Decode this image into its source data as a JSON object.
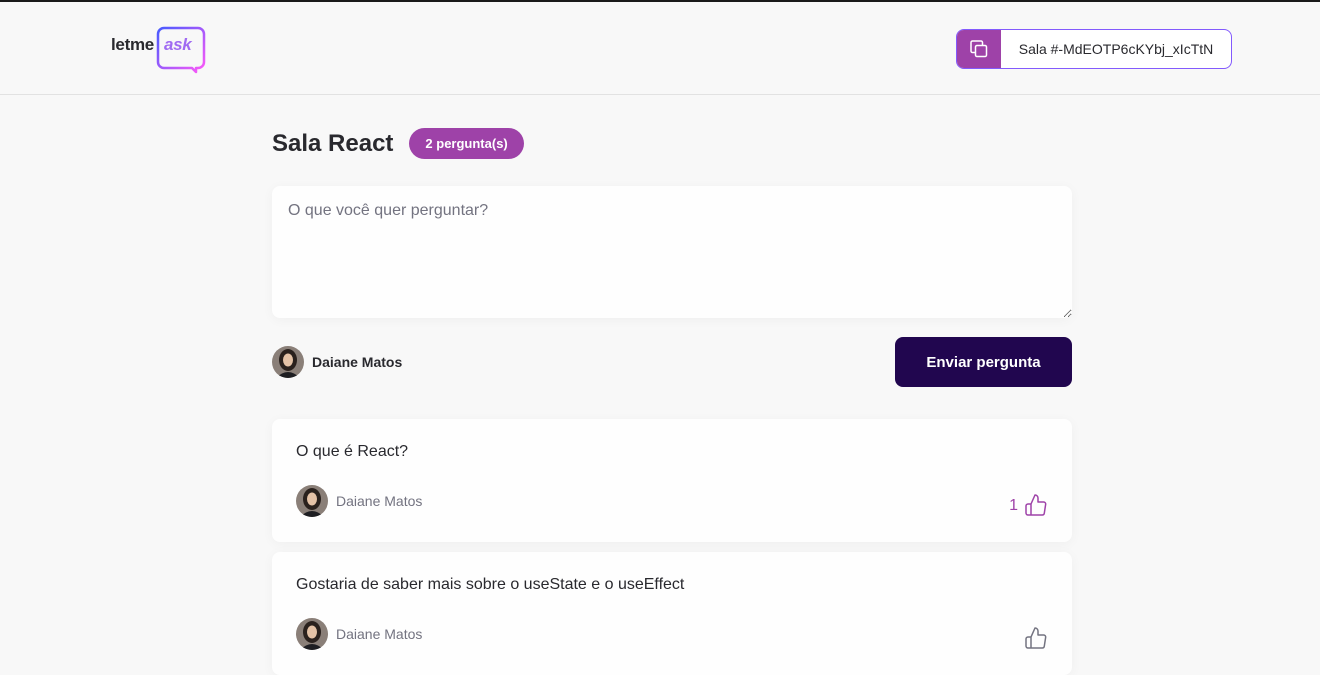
{
  "header": {
    "logo": {
      "part1": "letme",
      "part2": "ask"
    },
    "room_code_label": "Sala #-MdEOTP6cKYbj_xIcTtN"
  },
  "room": {
    "title": "Sala React",
    "question_count_badge": "2 pergunta(s)"
  },
  "form": {
    "placeholder": "O que você quer perguntar?",
    "value": "",
    "user_name": "Daiane Matos",
    "submit_label": "Enviar pergunta"
  },
  "questions": [
    {
      "content": "O que é React?",
      "author": "Daiane Matos",
      "like_count": "1",
      "liked": true
    },
    {
      "content": "Gostaria de saber mais sobre o useState e o useEffect",
      "author": "Daiane Matos",
      "like_count": "",
      "liked": false
    }
  ],
  "colors": {
    "primary": "#9e42a8",
    "dark_button": "#21064f",
    "text": "#29292e",
    "muted": "#737380",
    "background": "#f8f8f8",
    "logo_accent": "#a06bf2"
  },
  "icons": [
    "copy-icon",
    "like-icon",
    "chat-bubble-logo",
    "avatar"
  ]
}
